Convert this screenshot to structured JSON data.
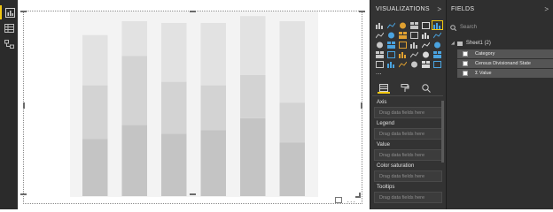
{
  "visualizations_pane": {
    "title": "VISUALIZATIONS",
    "chevron": ">",
    "more": "...",
    "wells": [
      {
        "label": "Axis",
        "placeholder": "Drag data fields here"
      },
      {
        "label": "Legend",
        "placeholder": "Drag data fields here"
      },
      {
        "label": "Value",
        "placeholder": "Drag data fields here"
      },
      {
        "label": "Color saturation",
        "placeholder": "Drag data fields here"
      },
      {
        "label": "Tooltips",
        "placeholder": "Drag data fields here"
      }
    ]
  },
  "fields_pane": {
    "title": "FIELDS",
    "chevron": ">",
    "search_placeholder": "Search",
    "table_name": "Sheet1 (2)",
    "fields": [
      "Category",
      "Census Divisionand State",
      "Σ Value"
    ]
  },
  "colors": {
    "accent": "#f2c811",
    "pane_dark": "#333333",
    "bar_dark": "#c4c4c4",
    "bar_mid": "#d3d3d3",
    "bar_light": "#e2e2e2"
  },
  "chart_data": {
    "type": "bar",
    "stacked": true,
    "placeholder_preview": true,
    "categories": [
      "",
      "",
      "",
      "",
      "",
      ""
    ],
    "series": [
      {
        "values": [
          33,
          41,
          36,
          38,
          45,
          31
        ]
      },
      {
        "values": [
          31,
          40,
          30,
          26,
          25,
          23
        ]
      },
      {
        "values": [
          29,
          20,
          34,
          36,
          34,
          47
        ]
      }
    ],
    "ylim": [
      0,
      100
    ],
    "grid": false
  }
}
